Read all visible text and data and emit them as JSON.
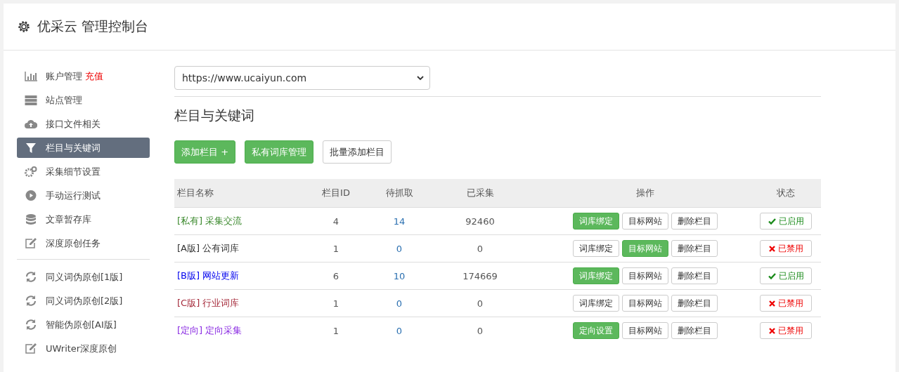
{
  "header": {
    "title": "优采云 管理控制台"
  },
  "sidebar": {
    "items": [
      {
        "label": "账户管理",
        "badge": "充值",
        "selected": false
      },
      {
        "label": "站点管理",
        "selected": false
      },
      {
        "label": "接口文件相关",
        "selected": false
      },
      {
        "label": "栏目与关键词",
        "selected": true
      },
      {
        "label": "采集细节设置",
        "selected": false
      },
      {
        "label": "手动运行测试",
        "selected": false
      },
      {
        "label": "文章暂存库",
        "selected": false
      },
      {
        "label": "深度原创任务",
        "selected": false
      }
    ],
    "tools": [
      {
        "label": "同义词伪原创[1版]",
        "selected": false
      },
      {
        "label": "同义词伪原创[2版]",
        "selected": false
      },
      {
        "label": "智能伪原创[AI版]",
        "selected": false
      },
      {
        "label": "UWriter深度原创",
        "selected": false
      }
    ]
  },
  "site_select": {
    "value": "https://www.ucaiyun.com"
  },
  "section_title": "栏目与关键词",
  "toolbar": [
    {
      "label": "添加栏目 +",
      "primary": true
    },
    {
      "label": "私有词库管理",
      "primary": true
    },
    {
      "label": "批量添加栏目",
      "primary": false
    }
  ],
  "table": {
    "columns": [
      "栏目名称",
      "栏目ID",
      "待抓取",
      "已采集",
      "操作",
      "状态"
    ],
    "rows": [
      {
        "tag": "[私有]",
        "name": "采集交流",
        "color": "#3c8a2e",
        "id": "4",
        "pending": "14",
        "collected": "92460",
        "actions": [
          {
            "label": "词库绑定",
            "primary": true
          },
          {
            "label": "目标网站",
            "primary": false
          },
          {
            "label": "删除栏目",
            "primary": false
          }
        ],
        "status": {
          "label": "已启用",
          "enabled": true
        }
      },
      {
        "tag": "[A版]",
        "name": "公有词库",
        "color": "#333333",
        "id": "1",
        "pending": "0",
        "collected": "0",
        "actions": [
          {
            "label": "词库绑定",
            "primary": false
          },
          {
            "label": "目标网站",
            "primary": true
          },
          {
            "label": "删除栏目",
            "primary": false
          }
        ],
        "status": {
          "label": "已禁用",
          "enabled": false
        }
      },
      {
        "tag": "[B版]",
        "name": "网站更新",
        "color": "#0000ee",
        "id": "6",
        "pending": "10",
        "collected": "174669",
        "actions": [
          {
            "label": "词库绑定",
            "primary": true
          },
          {
            "label": "目标网站",
            "primary": false
          },
          {
            "label": "删除栏目",
            "primary": false
          }
        ],
        "status": {
          "label": "已启用",
          "enabled": true
        }
      },
      {
        "tag": "[C版]",
        "name": "行业词库",
        "color": "#a52a3a",
        "id": "1",
        "pending": "0",
        "collected": "0",
        "actions": [
          {
            "label": "词库绑定",
            "primary": false
          },
          {
            "label": "目标网站",
            "primary": false
          },
          {
            "label": "删除栏目",
            "primary": false
          }
        ],
        "status": {
          "label": "已禁用",
          "enabled": false
        }
      },
      {
        "tag": "[定向]",
        "name": "定向采集",
        "color": "#8a2be2",
        "id": "1",
        "pending": "0",
        "collected": "0",
        "actions": [
          {
            "label": "定向设置",
            "primary": true
          },
          {
            "label": "目标网站",
            "primary": false
          },
          {
            "label": "删除栏目",
            "primary": false
          }
        ],
        "status": {
          "label": "已禁用",
          "enabled": false
        }
      }
    ]
  }
}
